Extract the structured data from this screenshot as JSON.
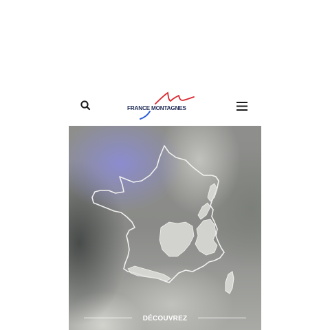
{
  "header": {
    "search_icon": "search-icon",
    "menu_icon": "hamburger-menu-icon",
    "logo_text": "FRANCE MONTAGNES",
    "logo_colors": {
      "text": "#1e2a55",
      "red": "#d9262e",
      "blue": "#2a5bd7"
    }
  },
  "hero": {
    "map_icon": "france-mountains-map",
    "discover_label": "DÉCOUVREZ"
  }
}
